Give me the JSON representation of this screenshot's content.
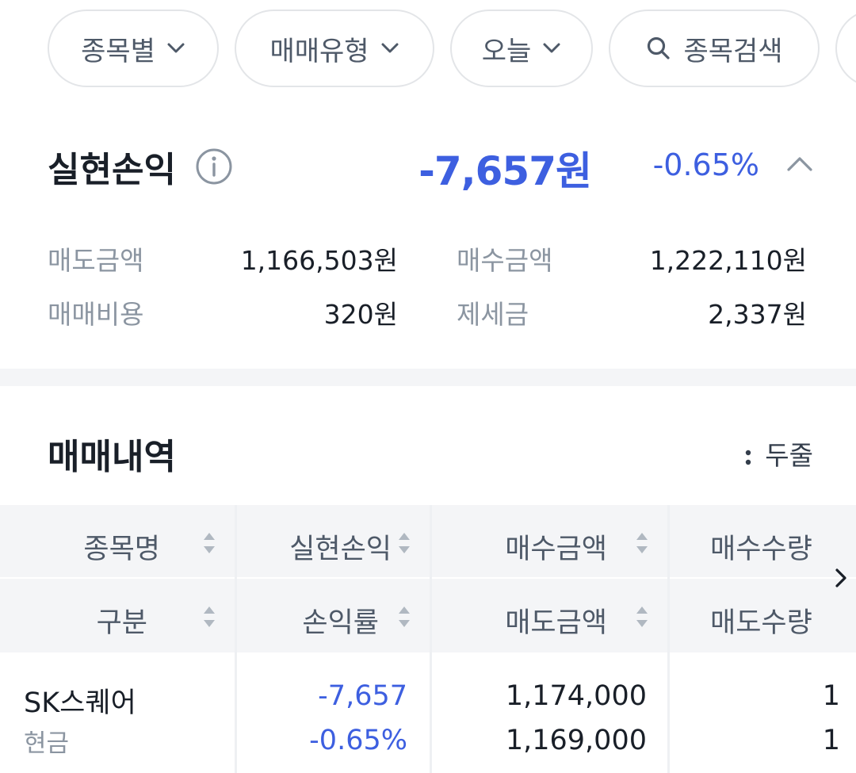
{
  "filters": {
    "by_stock": "종목별",
    "trade_type": "매매유형",
    "period": "오늘",
    "search": "종목검색"
  },
  "summary": {
    "title": "실현손익",
    "amount": "-7,657원",
    "rate": "-0.65%",
    "rows": [
      {
        "label": "매도금액",
        "value": "1,166,503원"
      },
      {
        "label": "매수금액",
        "value": "1,222,110원"
      },
      {
        "label": "매매비용",
        "value": "320원"
      },
      {
        "label": "제세금",
        "value": "2,337원"
      }
    ]
  },
  "history": {
    "title": "매매내역",
    "view_toggle": "두줄",
    "header_row1": [
      "종목명",
      "실현손익",
      "매수금액",
      "매수수량"
    ],
    "header_row2": [
      "구분",
      "손익률",
      "매도금액",
      "매도수량"
    ],
    "rows": [
      {
        "name": "SK스퀘어",
        "kind": "현금",
        "realized_pl": "-7,657",
        "pl_rate": "-0.65%",
        "buy_amount": "1,174,000",
        "sell_amount": "1,169,000",
        "buy_qty": "1",
        "sell_qty": "1"
      }
    ]
  },
  "colors": {
    "loss_blue": "#3d5fe0",
    "label_gray": "#8b95a1",
    "header_bg": "#f4f5f7"
  },
  "icons": {
    "chip_dropdown": "chevron-down-icon",
    "search": "search-icon",
    "info": "info-icon",
    "collapse": "chevron-up-icon",
    "sort": "sort-arrows-icon",
    "scroll_right": "chevron-right-icon",
    "view_toggle": "vertical-dots-icon"
  }
}
